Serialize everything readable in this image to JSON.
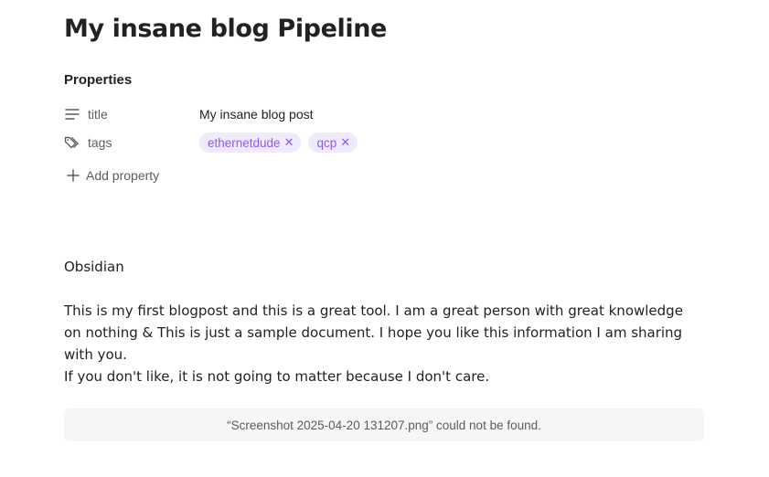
{
  "note": {
    "title": "My insane blog Pipeline"
  },
  "properties": {
    "heading": "Properties",
    "rows": [
      {
        "key": "title",
        "icon": "text-lines-icon",
        "value": "My insane blog post"
      },
      {
        "key": "tags",
        "icon": "tags-icon",
        "tags": [
          {
            "label": "ethernetdude",
            "remove": "✕"
          },
          {
            "label": "qcp",
            "remove": "✕"
          }
        ]
      }
    ],
    "add_label": "Add property",
    "add_icon": "plus-icon"
  },
  "content": {
    "paragraphs": [
      "Obsidian",
      "This is my first blogpost and this is a great tool. I am a great person with great knowledge on nothing & This is just a sample document. I hope you like this information I am sharing with you.",
      "If you don't like, it is not going to matter because I don't care."
    ],
    "missing_embed": "“Screenshot 2025-04-20 131207.png” could not be found."
  },
  "colors": {
    "tag_background": "#efeafc",
    "tag_text": "#8a5cf5",
    "muted_text": "#5c5c5c",
    "body_text": "#222222",
    "embed_background": "#f6f6f6"
  }
}
